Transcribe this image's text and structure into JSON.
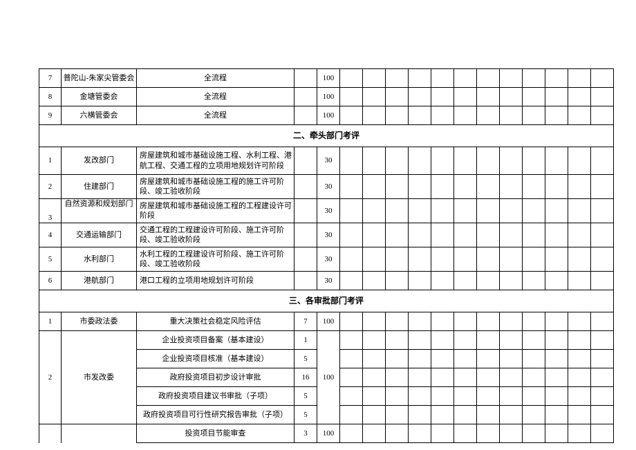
{
  "rows_top": [
    {
      "n": "7",
      "org": "普陀山-朱家尖管委会",
      "proc": "全流程",
      "sc": "100"
    },
    {
      "n": "8",
      "org": "金塘管委会",
      "proc": "全流程",
      "sc": "100"
    },
    {
      "n": "9",
      "org": "六横管委会",
      "proc": "全流程",
      "sc": "100"
    }
  ],
  "section2_title": "二、牵头部门考评",
  "rows_s2": [
    {
      "n": "1",
      "org": "发改部门",
      "desc": "房屋建筑和城市基础设施工程、水利工程、港航工程、交通工程的立项用地规划许可阶段",
      "sc": "30"
    },
    {
      "n": "2",
      "org": "住建部门",
      "desc": "房屋建筑和城市基础设施工程的施工许可阶段、竣工验收阶段",
      "sc": "30"
    },
    {
      "n": "3",
      "org": "自然资源和规划部门",
      "desc": "房屋建筑和城市基础设施工程的工程建设许可阶段",
      "sc": "30"
    },
    {
      "n": "4",
      "org": "交通运输部门",
      "desc": "交通工程的工程建设许可阶段、施工许可阶段、竣工验收阶段",
      "sc": "30"
    },
    {
      "n": "5",
      "org": "水利部门",
      "desc": "水利工程的工程建设许可阶段、施工许可阶段、竣工验收阶段",
      "sc": "30"
    },
    {
      "n": "6",
      "org": "港航部门",
      "desc": "港口工程的立项用地规划许可阶段",
      "sc": "30"
    }
  ],
  "section3_title": "三、各审批部门考评",
  "s3_r1": {
    "n": "1",
    "org": "市委政法委",
    "desc": "重大决策社会稳定风险评估",
    "v": "7",
    "sc": "100"
  },
  "s3_r2": {
    "n": "2",
    "org": "市发改委",
    "items": [
      {
        "desc": "企业投资项目备案（基本建设）",
        "v": "1"
      },
      {
        "desc": "企业投资项目核准（基本建设）",
        "v": "5"
      },
      {
        "desc": "政府投资项目初步设计审批",
        "v": "16"
      },
      {
        "desc": "政府投资项目建议书审批（子项）",
        "v": "5"
      },
      {
        "desc": "政府投资项目可行性研究报告审批（子项）",
        "v": "5"
      }
    ],
    "sc": "100"
  },
  "s3_last": {
    "desc": "投资项目节能审查",
    "v": "3",
    "sc": "100"
  }
}
